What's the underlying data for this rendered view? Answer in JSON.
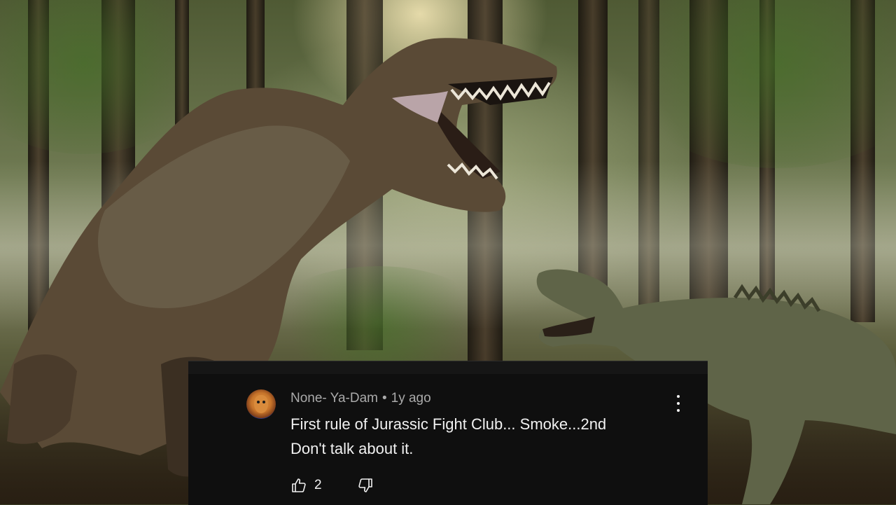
{
  "comment": {
    "author": "None- Ya-Dam",
    "separator": "•",
    "time": "1y ago",
    "text_line1": "First rule of Jurassic Fight Club... Smoke...2nd",
    "text_line2": "Don't talk about it.",
    "like_count": "2"
  },
  "icons": {
    "like": "thumbs-up-icon",
    "dislike": "thumbs-down-icon",
    "more": "more-vert-icon"
  },
  "colors": {
    "card_background": "#0f0f0f",
    "primary_text": "#f1f1f1",
    "secondary_text": "#aaaaaa"
  }
}
